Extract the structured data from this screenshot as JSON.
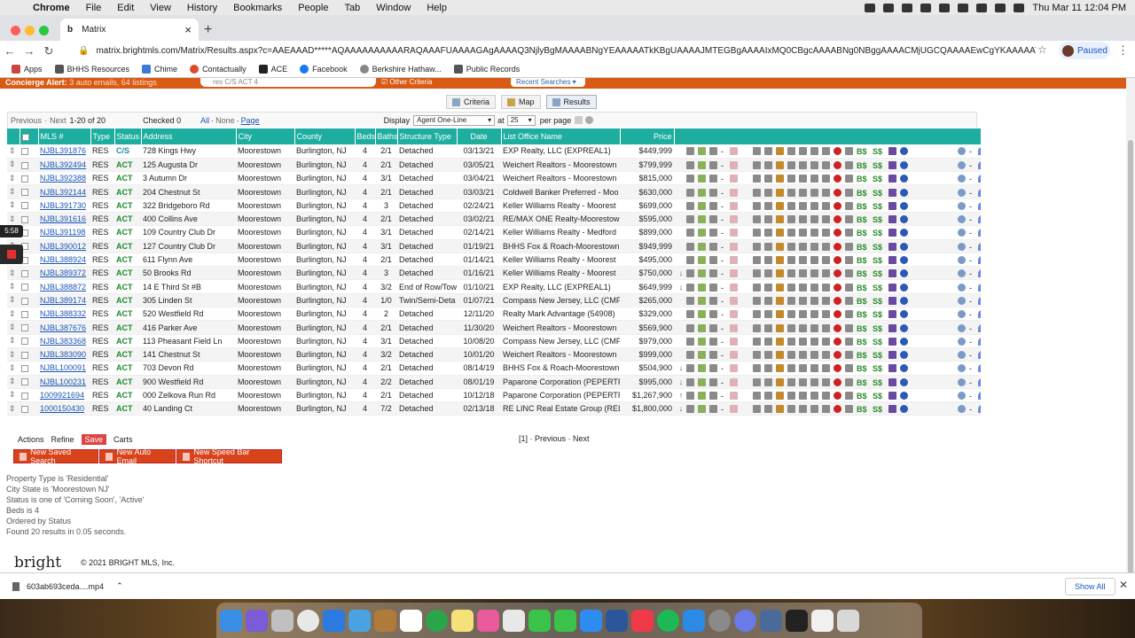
{
  "menubar": {
    "app": "Chrome",
    "items": [
      "File",
      "Edit",
      "View",
      "History",
      "Bookmarks",
      "People",
      "Tab",
      "Window",
      "Help"
    ],
    "clock": "Thu Mar 11  12:04 PM"
  },
  "browser": {
    "tab_title": "Matrix",
    "url": "matrix.brightmls.com/Matrix/Results.aspx?c=AAEAAAD*****AQAAAAAAAAAARAQAAAFUAAAAGAgAAAAQ3NjlyBgMAAAABNgYEAAAAATkKBgUAAAAJMTEGBgAAAAIxMQ0CBgcAAAABNg0NBggAAAACMjUGCQAAAAEwCgYKAAAAATANLQYLA...",
    "paused_label": "Paused",
    "bookmarks": [
      "Apps",
      "BHHS Resources",
      "Chime",
      "Contactually",
      "ACE",
      "Facebook",
      "Berkshire Hathaw...",
      "Public Records"
    ]
  },
  "banner": {
    "concierge": "Concierge Alert:",
    "concierge_sub": " 3 auto emails, 64 listings",
    "search_text": "res C/S ACT 4",
    "other_criteria": "Other Criteria",
    "recent": "Recent Searches"
  },
  "view_tabs": [
    "Criteria",
    "Map",
    "Results"
  ],
  "controls": {
    "previous": "Previous",
    "next": "Next",
    "range": "1-20 of 20",
    "checked": "Checked 0",
    "all": "All",
    "none": "None",
    "page": "Page",
    "display_label": "Display",
    "display_value": "Agent One-Line",
    "at": "at",
    "per_page_value": "25",
    "per_page_label": "per page"
  },
  "columns": [
    "MLS #",
    "Type",
    "Status",
    "Address",
    "City",
    "County",
    "Beds",
    "Baths",
    "Structure Type",
    "Date",
    "List Office Name",
    "Price"
  ],
  "rows": [
    {
      "mls": "NJBL391876",
      "type": "RES",
      "status": "C/S",
      "address": "728 Kings Hwy",
      "city": "Moorestown",
      "county": "Burlington, NJ",
      "beds": "4",
      "baths": "2/1",
      "structure": "Detached",
      "date": "03/13/21",
      "office": "EXP Realty, LLC (EXPREAL1)",
      "price": "$449,999",
      "arrow": ""
    },
    {
      "mls": "NJBL392494",
      "type": "RES",
      "status": "ACT",
      "address": "125 Augusta Dr",
      "city": "Moorestown",
      "county": "Burlington, NJ",
      "beds": "4",
      "baths": "2/1",
      "structure": "Detached",
      "date": "03/05/21",
      "office": "Weichert Realtors - Moorestown",
      "price": "$799,999",
      "arrow": ""
    },
    {
      "mls": "NJBL392388",
      "type": "RES",
      "status": "ACT",
      "address": "3 Autumn Dr",
      "city": "Moorestown",
      "county": "Burlington, NJ",
      "beds": "4",
      "baths": "3/1",
      "structure": "Detached",
      "date": "03/04/21",
      "office": "Weichert Realtors - Moorestown",
      "price": "$815,000",
      "arrow": ""
    },
    {
      "mls": "NJBL392144",
      "type": "RES",
      "status": "ACT",
      "address": "204 Chestnut St",
      "city": "Moorestown",
      "county": "Burlington, NJ",
      "beds": "4",
      "baths": "2/1",
      "structure": "Detached",
      "date": "03/03/21",
      "office": "Coldwell Banker Preferred - Moo",
      "price": "$630,000",
      "arrow": ""
    },
    {
      "mls": "NJBL391730",
      "type": "RES",
      "status": "ACT",
      "address": "322 Bridgeboro Rd",
      "city": "Moorestown",
      "county": "Burlington, NJ",
      "beds": "4",
      "baths": "3",
      "structure": "Detached",
      "date": "02/24/21",
      "office": "Keller Williams Realty - Moorest",
      "price": "$699,000",
      "arrow": ""
    },
    {
      "mls": "NJBL391616",
      "type": "RES",
      "status": "ACT",
      "address": "400 Collins Ave",
      "city": "Moorestown",
      "county": "Burlington, NJ",
      "beds": "4",
      "baths": "2/1",
      "structure": "Detached",
      "date": "03/02/21",
      "office": "RE/MAX ONE Realty-Moorestowr",
      "price": "$595,000",
      "arrow": ""
    },
    {
      "mls": "NJBL391198",
      "type": "RES",
      "status": "ACT",
      "address": "109 Country Club Dr",
      "city": "Moorestown",
      "county": "Burlington, NJ",
      "beds": "4",
      "baths": "3/1",
      "structure": "Detached",
      "date": "02/14/21",
      "office": "Keller Williams Realty - Medford",
      "price": "$899,000",
      "arrow": ""
    },
    {
      "mls": "NJBL390012",
      "type": "RES",
      "status": "ACT",
      "address": "127 Country Club Dr",
      "city": "Moorestown",
      "county": "Burlington, NJ",
      "beds": "4",
      "baths": "3/1",
      "structure": "Detached",
      "date": "01/19/21",
      "office": "BHHS Fox & Roach-Moorestown",
      "price": "$949,999",
      "arrow": ""
    },
    {
      "mls": "NJBL388924",
      "type": "RES",
      "status": "ACT",
      "address": "611 Flynn Ave",
      "city": "Moorestown",
      "county": "Burlington, NJ",
      "beds": "4",
      "baths": "2/1",
      "structure": "Detached",
      "date": "01/14/21",
      "office": "Keller Williams Realty - Moorest",
      "price": "$495,000",
      "arrow": ""
    },
    {
      "mls": "NJBL389372",
      "type": "RES",
      "status": "ACT",
      "address": "50 Brooks Rd",
      "city": "Moorestown",
      "county": "Burlington, NJ",
      "beds": "4",
      "baths": "3",
      "structure": "Detached",
      "date": "01/16/21",
      "office": "Keller Williams Realty - Moorest",
      "price": "$750,000",
      "arrow": "down"
    },
    {
      "mls": "NJBL388872",
      "type": "RES",
      "status": "ACT",
      "address": "14 E Third St #B",
      "city": "Moorestown",
      "county": "Burlington, NJ",
      "beds": "4",
      "baths": "3/2",
      "structure": "End of Row/Tow",
      "date": "01/10/21",
      "office": "EXP Realty, LLC (EXPREAL1)",
      "price": "$649,999",
      "arrow": "down"
    },
    {
      "mls": "NJBL389174",
      "type": "RES",
      "status": "ACT",
      "address": "305 Linden St",
      "city": "Moorestown",
      "county": "Burlington, NJ",
      "beds": "4",
      "baths": "1/0",
      "structure": "Twin/Semi-Deta",
      "date": "01/07/21",
      "office": "Compass New Jersey, LLC (CMPI",
      "price": "$265,000",
      "arrow": ""
    },
    {
      "mls": "NJBL388332",
      "type": "RES",
      "status": "ACT",
      "address": "520 Westfield Rd",
      "city": "Moorestown",
      "county": "Burlington, NJ",
      "beds": "4",
      "baths": "2",
      "structure": "Detached",
      "date": "12/11/20",
      "office": "Realty Mark Advantage (54908)",
      "price": "$329,000",
      "arrow": ""
    },
    {
      "mls": "NJBL387676",
      "type": "RES",
      "status": "ACT",
      "address": "416 Parker Ave",
      "city": "Moorestown",
      "county": "Burlington, NJ",
      "beds": "4",
      "baths": "2/1",
      "structure": "Detached",
      "date": "11/30/20",
      "office": "Weichert Realtors - Moorestown",
      "price": "$569,900",
      "arrow": ""
    },
    {
      "mls": "NJBL383368",
      "type": "RES",
      "status": "ACT",
      "address": "113 Pheasant Field Ln",
      "city": "Moorestown",
      "county": "Burlington, NJ",
      "beds": "4",
      "baths": "3/1",
      "structure": "Detached",
      "date": "10/08/20",
      "office": "Compass New Jersey, LLC (CMPI",
      "price": "$979,000",
      "arrow": ""
    },
    {
      "mls": "NJBL383090",
      "type": "RES",
      "status": "ACT",
      "address": "141 Chestnut St",
      "city": "Moorestown",
      "county": "Burlington, NJ",
      "beds": "4",
      "baths": "3/2",
      "structure": "Detached",
      "date": "10/01/20",
      "office": "Weichert Realtors - Moorestown",
      "price": "$999,000",
      "arrow": ""
    },
    {
      "mls": "NJBL100091",
      "type": "RES",
      "status": "ACT",
      "address": "703 Devon Rd",
      "city": "Moorestown",
      "county": "Burlington, NJ",
      "beds": "4",
      "baths": "2/1",
      "structure": "Detached",
      "date": "08/14/19",
      "office": "BHHS Fox & Roach-Moorestown",
      "price": "$504,900",
      "arrow": "down"
    },
    {
      "mls": "NJBL100231",
      "type": "RES",
      "status": "ACT",
      "address": "900 Westfield Rd",
      "city": "Moorestown",
      "county": "Burlington, NJ",
      "beds": "4",
      "baths": "2/2",
      "structure": "Detached",
      "date": "08/01/19",
      "office": "Paparone Corporation (PEPERTR",
      "price": "$995,000",
      "arrow": "down"
    },
    {
      "mls": "1009921694",
      "type": "RES",
      "status": "ACT",
      "address": "000 Zelkova Run Rd",
      "city": "Moorestown",
      "county": "Burlington, NJ",
      "beds": "4",
      "baths": "2/1",
      "structure": "Detached",
      "date": "10/12/18",
      "office": "Paparone Corporation (PEPERTR",
      "price": "$1,267,900",
      "arrow": "up"
    },
    {
      "mls": "1000150430",
      "type": "RES",
      "status": "ACT",
      "address": "40 Landing Ct",
      "city": "Moorestown",
      "county": "Burlington, NJ",
      "beds": "4",
      "baths": "7/2",
      "structure": "Detached",
      "date": "02/13/18",
      "office": "RE LINC Real Estate Group (REL",
      "price": "$1,800,000",
      "arrow": "down"
    }
  ],
  "bottom": {
    "actions": "Actions",
    "refine": "Refine",
    "save": "Save",
    "carts": "Carts",
    "pager": "[1]  ·  Previous  ·  Next",
    "buttons": [
      "New Saved Search",
      "New Auto Email",
      "New Speed Bar Shortcut"
    ],
    "criteria": [
      "Property Type is 'Residential'",
      "City State is 'Moorestown NJ'",
      "Status is one of 'Coming Soon', 'Active'",
      "Beds is 4",
      "Ordered by Status",
      "Found 20 results in 0.05 seconds."
    ],
    "logo": "bright",
    "copyright": "© 2021 BRIGHT MLS, Inc."
  },
  "side": {
    "timer": "5:58"
  },
  "download": {
    "file": "603ab693ceda....mp4",
    "show_all": "Show All"
  },
  "colors": {
    "header": "#1eae9f",
    "banner": "#d95a14",
    "link": "#1a55b5",
    "active": "#1a8a2a"
  }
}
